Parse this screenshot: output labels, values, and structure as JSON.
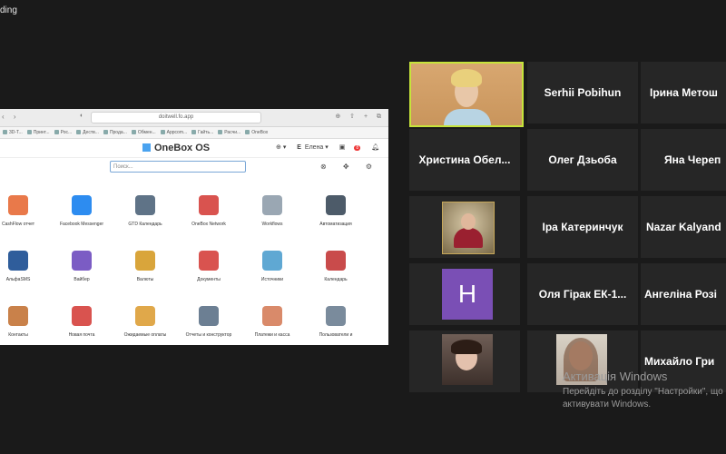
{
  "status_text": "ding",
  "browser": {
    "url": "doitwell.fo.app",
    "bookmarks": [
      "3D-Т...",
      "Принт...",
      "Рос...",
      "Деств...",
      "Прода...",
      "Обмен...",
      "Appcom...",
      "Гайть...",
      "Расчи...",
      "OneBox"
    ]
  },
  "app": {
    "logo": "OneBox OS",
    "user_initial": "E",
    "user_name": "Елена",
    "badge": "8",
    "search_placeholder": "Поиск...",
    "tiles": [
      {
        "label": "CashFlow отчет",
        "color": "#e9794a"
      },
      {
        "label": "Facebook Messenger",
        "color": "#2d8cf0"
      },
      {
        "label": "GTD Календарь",
        "color": "#5f7387"
      },
      {
        "label": "OneBox Network",
        "color": "#d9534f"
      },
      {
        "label": "Workflows",
        "color": "#9aa7b3"
      },
      {
        "label": "Автоматизация",
        "color": "#4d5b69"
      },
      {
        "label": "АльфаSMS",
        "color": "#2f5d9b"
      },
      {
        "label": "Вайбер",
        "color": "#7b5cc4"
      },
      {
        "label": "Валюты",
        "color": "#d9a53b"
      },
      {
        "label": "Документы",
        "color": "#d9534f"
      },
      {
        "label": "Источники",
        "color": "#5fa8d3"
      },
      {
        "label": "Календарь",
        "color": "#c94b4b"
      },
      {
        "label": "Контакты",
        "color": "#c9814a"
      },
      {
        "label": "Новая почта",
        "color": "#d9534f"
      },
      {
        "label": "Ожидаемые оплаты",
        "color": "#e0a84a"
      },
      {
        "label": "Отчеты и конструктор",
        "color": "#6c7f93"
      },
      {
        "label": "Платежи и касса",
        "color": "#d98a6a"
      },
      {
        "label": "Пользователи и",
        "color": "#7a8b9c"
      }
    ]
  },
  "participants": {
    "sergii": "Serhii Pobihun",
    "iryna_m": "Ірина Метош",
    "khrystyna": "Христина Обел...",
    "oleh": "Олег Дзьоба",
    "yana": "Яна Череп",
    "ira_k": "Іра Катеринчук",
    "nazar": "Nazar Kalyand",
    "h_initial": "H",
    "olia": "Оля Гірак ЕК-1...",
    "anhelina": "Ангеліна Розі",
    "mykhailo": "Михайло Гри"
  },
  "activation": {
    "title": "Активація Windows",
    "line1": "Перейдіть до розділу \"Настройки\", що",
    "line2": "активувати Windows."
  }
}
